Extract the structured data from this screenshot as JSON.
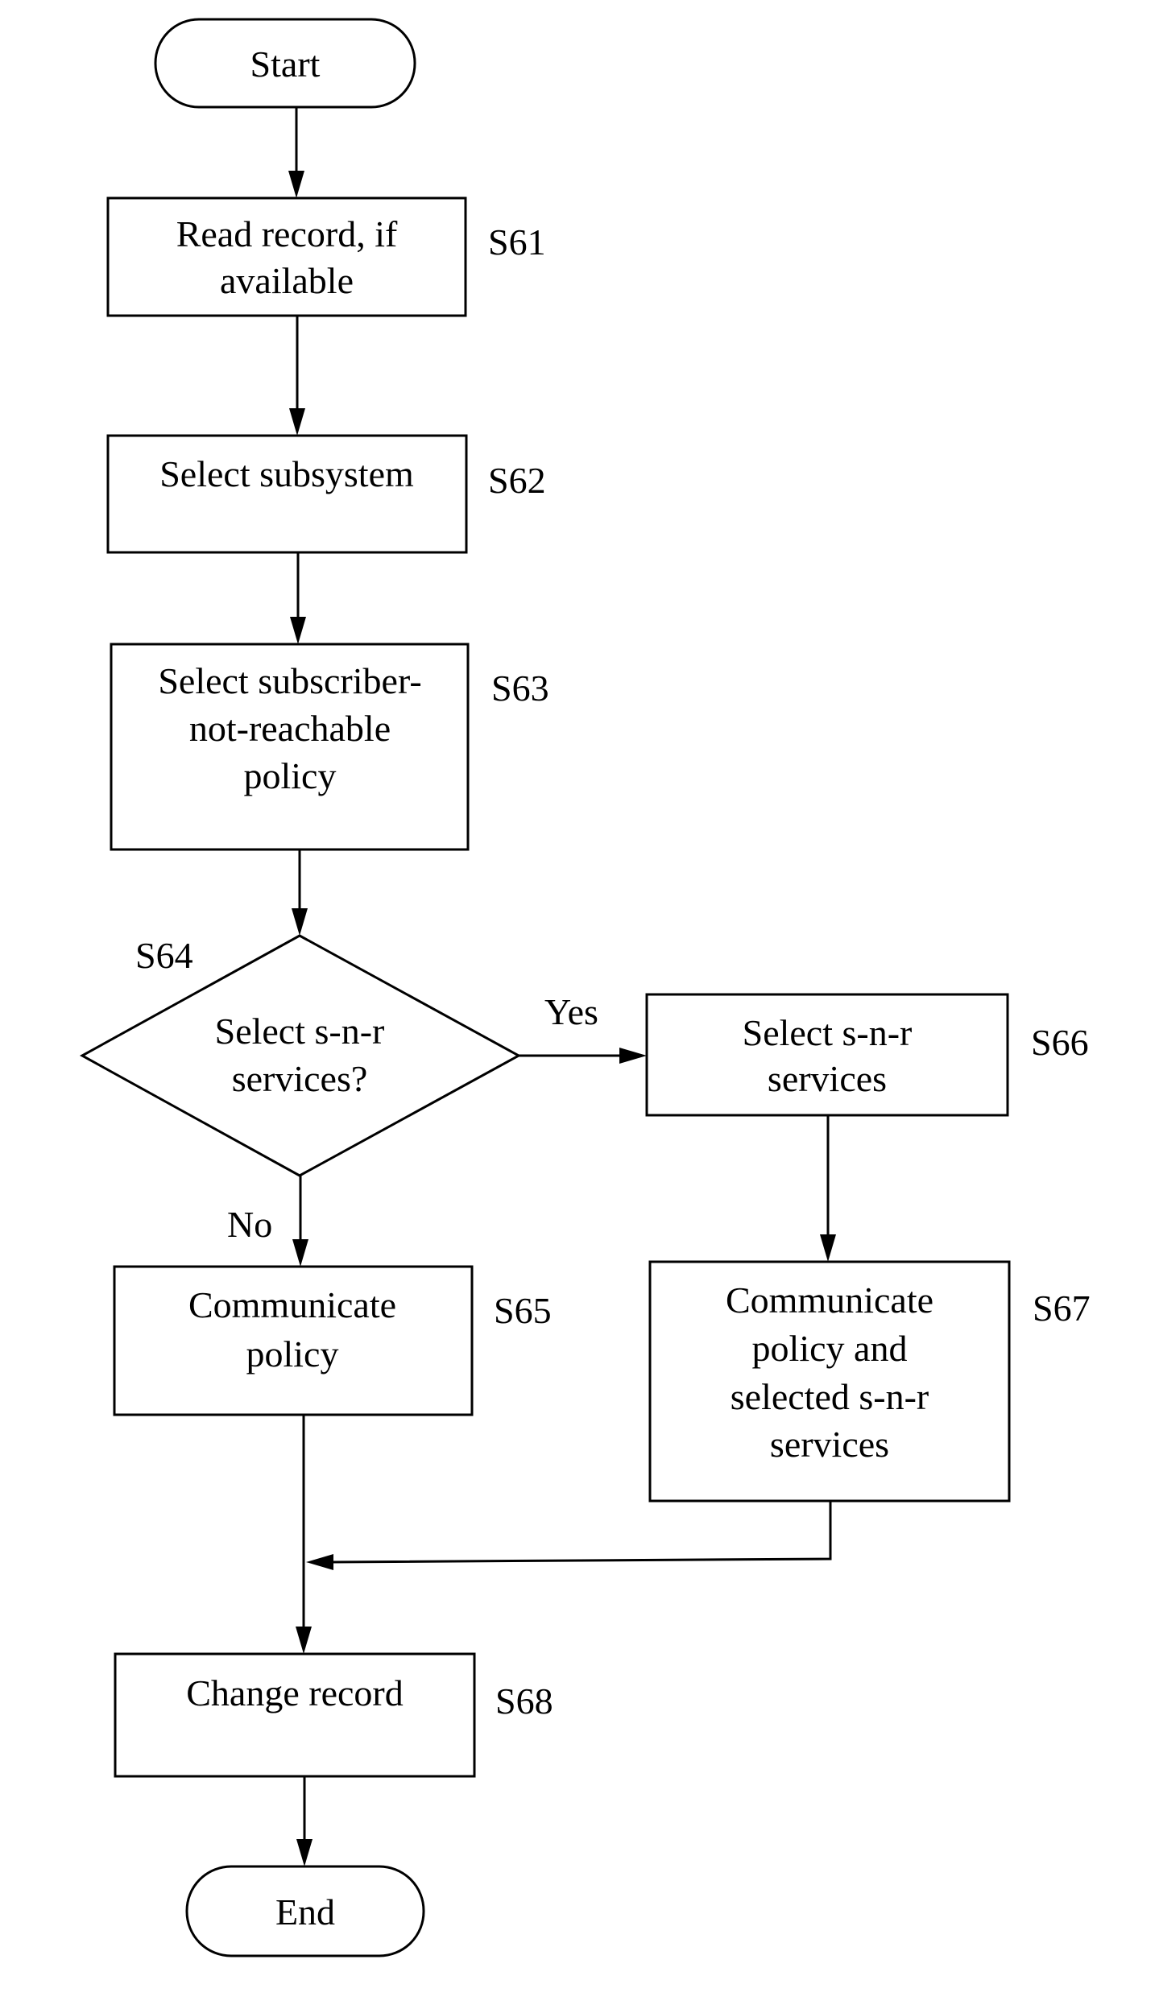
{
  "flowchart": {
    "start": {
      "text": "Start"
    },
    "end": {
      "text": "End"
    },
    "steps": {
      "s61": {
        "id": "S61",
        "lines": [
          "Read record, if",
          "available"
        ]
      },
      "s62": {
        "id": "S62",
        "lines": [
          "Select subsystem"
        ]
      },
      "s63": {
        "id": "S63",
        "lines": [
          "Select subscriber-",
          "not-reachable",
          "policy"
        ]
      },
      "s64": {
        "id": "S64",
        "lines": [
          "Select s-n-r",
          "services?"
        ]
      },
      "s65": {
        "id": "S65",
        "lines": [
          "Communicate",
          "policy"
        ]
      },
      "s66": {
        "id": "S66",
        "lines": [
          "Select s-n-r",
          "services"
        ]
      },
      "s67": {
        "id": "S67",
        "lines": [
          "Communicate",
          "policy and",
          "selected s-n-r",
          "services"
        ]
      },
      "s68": {
        "id": "S68",
        "lines": [
          "Change record"
        ]
      }
    },
    "branches": {
      "yes": "Yes",
      "no": "No"
    },
    "edges": [
      [
        "start",
        "s61"
      ],
      [
        "s61",
        "s62"
      ],
      [
        "s62",
        "s63"
      ],
      [
        "s63",
        "s64"
      ],
      [
        "s64",
        "s66",
        "Yes"
      ],
      [
        "s64",
        "s65",
        "No"
      ],
      [
        "s66",
        "s67"
      ],
      [
        "s65",
        "s68"
      ],
      [
        "s67",
        "s68"
      ],
      [
        "s68",
        "end"
      ]
    ]
  }
}
